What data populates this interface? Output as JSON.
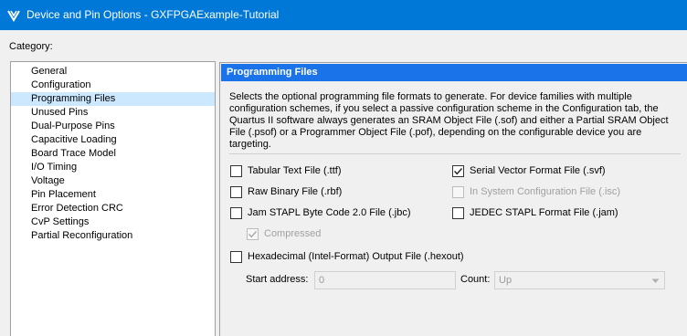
{
  "window": {
    "title": "Device and Pin Options - GXFPGAExample-Tutorial",
    "icon": "quartus-app-icon"
  },
  "category": {
    "label": "Category:",
    "items": [
      "General",
      "Configuration",
      "Programming Files",
      "Unused Pins",
      "Dual-Purpose Pins",
      "Capacitive Loading",
      "Board Trace Model",
      "I/O Timing",
      "Voltage",
      "Pin Placement",
      "Error Detection CRC",
      "CvP Settings",
      "Partial Reconfiguration"
    ],
    "selected": "Programming Files"
  },
  "panel": {
    "header": "Programming Files",
    "description": "Selects the optional programming file formats to generate. For device families with multiple configuration schemes, if you select a passive configuration scheme in the Configuration tab, the Quartus II software always generates an SRAM Object File (.sof) and either a Partial SRAM Object File (.psof) or a Programmer Object File (.pof), depending on the configurable device you are targeting.",
    "options": {
      "ttf": {
        "label": "Tabular Text File (.ttf)",
        "checked": false,
        "enabled": true
      },
      "svf": {
        "label": "Serial Vector Format File (.svf)",
        "checked": true,
        "enabled": true
      },
      "rbf": {
        "label": "Raw Binary File (.rbf)",
        "checked": false,
        "enabled": true
      },
      "isc": {
        "label": "In System Configuration File (.isc)",
        "checked": false,
        "enabled": false
      },
      "jbc": {
        "label": "Jam STAPL Byte Code 2.0 File (.jbc)",
        "checked": false,
        "enabled": true
      },
      "jam": {
        "label": "JEDEC STAPL Format File (.jam)",
        "checked": false,
        "enabled": true
      },
      "compressed": {
        "label": "Compressed",
        "checked": true,
        "enabled": false
      },
      "hexout": {
        "label": "Hexadecimal (Intel-Format) Output File (.hexout)",
        "checked": false,
        "enabled": true
      }
    },
    "start_address": {
      "label": "Start address:",
      "value": "0"
    },
    "count": {
      "label": "Count:",
      "value": "Up"
    }
  }
}
